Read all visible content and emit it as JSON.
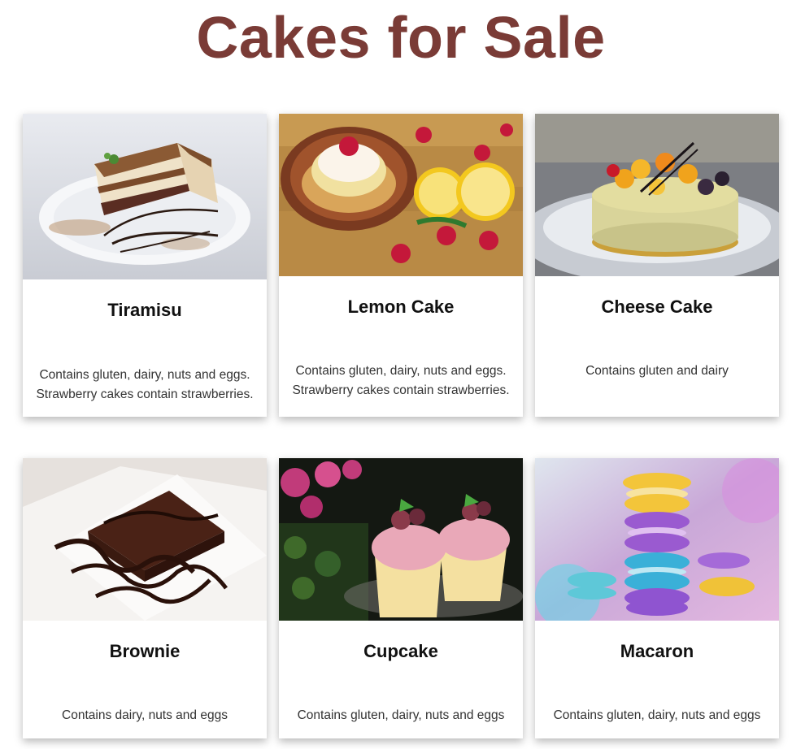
{
  "page": {
    "title": "Cakes for Sale"
  },
  "cakes": [
    {
      "name": "Tiramisu",
      "description": "Contains gluten, dairy, nuts and eggs. Strawberry cakes contain strawberries.",
      "image": "tiramisu-slice-on-plate"
    },
    {
      "name": "Lemon Cake",
      "description": "Contains gluten, dairy, nuts and eggs. Strawberry cakes contain strawberries.",
      "image": "lemon-meringue-tart-with-lemons"
    },
    {
      "name": "Cheese Cake",
      "description": "Contains gluten and dairy",
      "image": "fruit-topped-cheesecake"
    },
    {
      "name": "Brownie",
      "description": "Contains dairy, nuts and eggs",
      "image": "brownie-with-chocolate-drizzle"
    },
    {
      "name": "Cupcake",
      "description": "Contains gluten, dairy, nuts and eggs",
      "image": "cupcakes-with-berries"
    },
    {
      "name": "Macaron",
      "description": "Contains gluten, dairy, nuts and eggs",
      "image": "stacked-colorful-macarons"
    }
  ]
}
